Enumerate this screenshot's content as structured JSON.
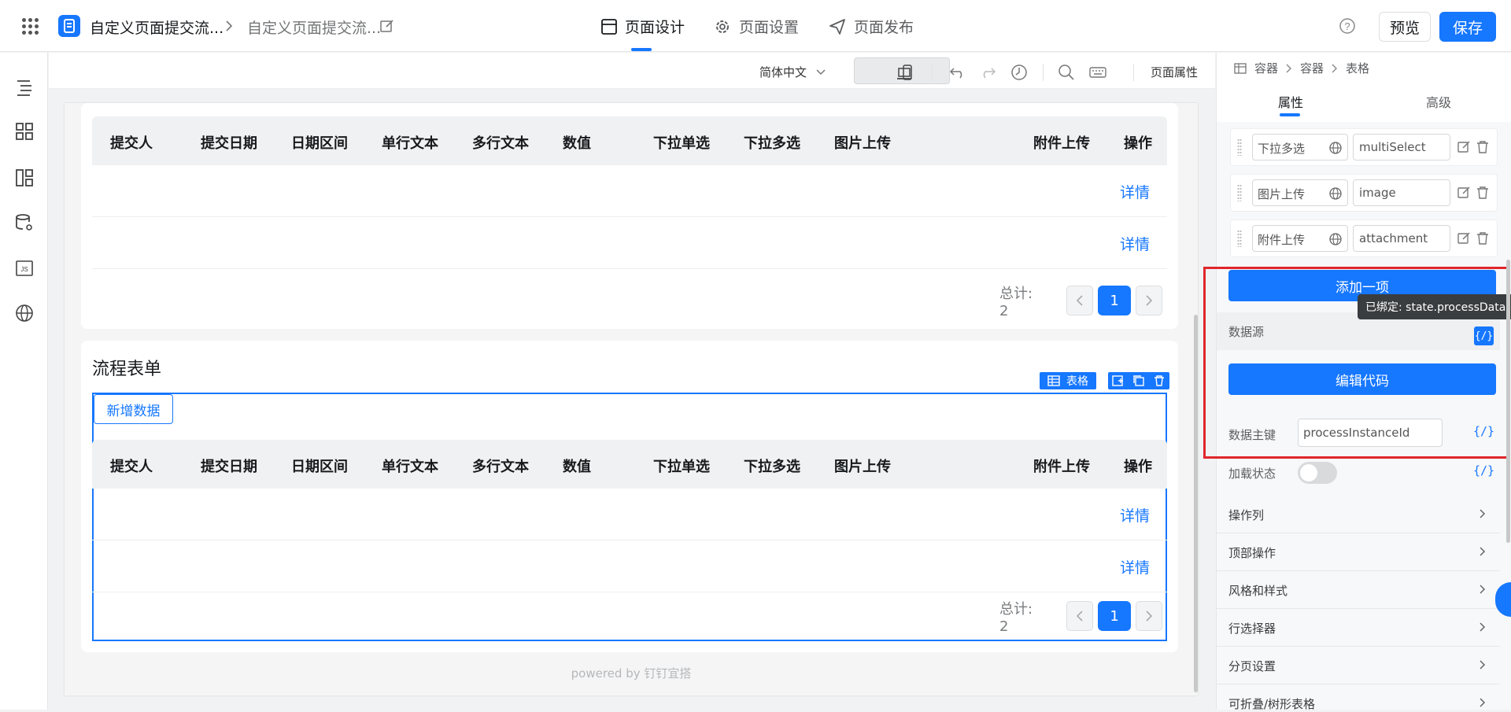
{
  "header": {
    "breadcrumb_app": "自定义页面提交流...",
    "breadcrumb_page": "自定义页面提交流...",
    "tabs": [
      {
        "label": "页面设计"
      },
      {
        "label": "页面设置"
      },
      {
        "label": "页面发布"
      }
    ],
    "preview_label": "预览",
    "save_label": "保存"
  },
  "toolbar": {
    "language": "简体中文",
    "page_props": "页面属性"
  },
  "table1": {
    "columns": [
      "提交人",
      "提交日期",
      "日期区间",
      "单行文本",
      "多行文本",
      "数值",
      "下拉单选",
      "下拉多选",
      "图片上传",
      "附件上传",
      "操作"
    ],
    "rows": [
      {
        "action": "详情"
      },
      {
        "action": "详情"
      }
    ],
    "total": "总计: 2",
    "current_page": "1"
  },
  "card2": {
    "title": "流程表单",
    "add_button": "新增数据",
    "component_tag": "表格",
    "columns": [
      "提交人",
      "提交日期",
      "日期区间",
      "单行文本",
      "多行文本",
      "数值",
      "下拉单选",
      "下拉多选",
      "图片上传",
      "附件上传",
      "操作"
    ],
    "rows": [
      {
        "action": "详情"
      },
      {
        "action": "详情"
      }
    ],
    "total": "总计: 2",
    "current_page": "1"
  },
  "powered": "powered by 钉钉宜搭",
  "panel": {
    "breadcrumb": [
      "容器",
      "容器",
      "表格"
    ],
    "tabs": [
      "属性",
      "高级"
    ],
    "items": [
      {
        "select": "下拉多选",
        "value": "multiSelect"
      },
      {
        "select": "图片上传",
        "value": "image"
      },
      {
        "select": "附件上传",
        "value": "attachment"
      }
    ],
    "add_item": "添加一项",
    "tooltip": "已绑定: state.processData",
    "datasource_label": "数据源",
    "bind_glyph": "{/}",
    "edit_code": "编辑代码",
    "pk_label": "数据主键",
    "pk_value": "processInstanceId",
    "loading_label": "加载状态",
    "sections": [
      "操作列",
      "顶部操作",
      "风格和样式",
      "行选择器",
      "分页设置",
      "可折叠/树形表格"
    ]
  },
  "colors": {
    "accent": "#1677ff",
    "highlight": "#e0262c"
  }
}
